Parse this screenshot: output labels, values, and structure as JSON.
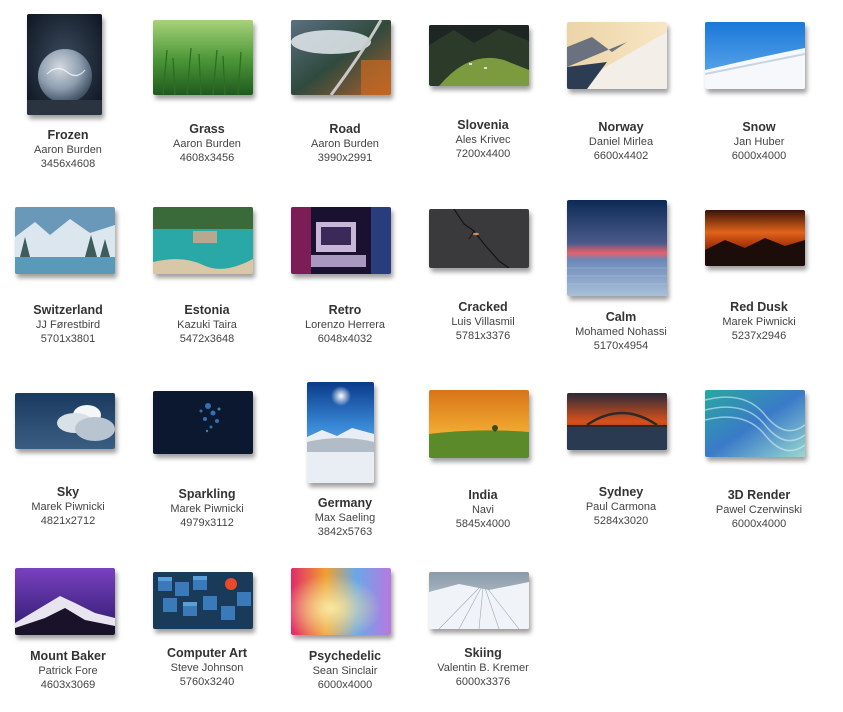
{
  "wallpapers": [
    {
      "name": "Frozen",
      "author": "Aaron Burden",
      "resolution": "3456x4608",
      "icon": "frozen-bubble-thumbnail"
    },
    {
      "name": "Grass",
      "author": "Aaron Burden",
      "resolution": "4608x3456",
      "icon": "grass-thumbnail"
    },
    {
      "name": "Road",
      "author": "Aaron Burden",
      "resolution": "3990x2991",
      "icon": "road-thumbnail"
    },
    {
      "name": "Slovenia",
      "author": "Ales Krivec",
      "resolution": "7200x4400",
      "icon": "slovenia-valley-thumbnail"
    },
    {
      "name": "Norway",
      "author": "Daniel Mirlea",
      "resolution": "6600x4402",
      "icon": "norway-snow-slope-thumbnail"
    },
    {
      "name": "Snow",
      "author": "Jan Huber",
      "resolution": "6000x4000",
      "icon": "snow-thumbnail"
    },
    {
      "name": "Switzerland",
      "author": "JJ Førestbird",
      "resolution": "5701x3801",
      "icon": "switzerland-lake-thumbnail"
    },
    {
      "name": "Estonia",
      "author": "Kazuki Taira",
      "resolution": "5472x3648",
      "icon": "estonia-water-thumbnail"
    },
    {
      "name": "Retro",
      "author": "Lorenzo Herrera",
      "resolution": "6048x4032",
      "icon": "retro-computer-thumbnail"
    },
    {
      "name": "Cracked",
      "author": "Luis Villasmil",
      "resolution": "5781x3376",
      "icon": "cracked-asphalt-thumbnail"
    },
    {
      "name": "Calm",
      "author": "Mohamed Nohassi",
      "resolution": "5170x4954",
      "icon": "calm-sea-sunset-thumbnail"
    },
    {
      "name": "Red Dusk",
      "author": "Marek Piwnicki",
      "resolution": "5237x2946",
      "icon": "red-dusk-mountains-thumbnail"
    },
    {
      "name": "Sky",
      "author": "Marek Piwnicki",
      "resolution": "4821x2712",
      "icon": "sky-clouds-thumbnail"
    },
    {
      "name": "Sparkling",
      "author": "Marek Piwnicki",
      "resolution": "4979x3112",
      "icon": "sparkling-lights-thumbnail"
    },
    {
      "name": "Germany",
      "author": "Max Saeling",
      "resolution": "3842x5763",
      "icon": "germany-sun-snow-thumbnail"
    },
    {
      "name": "India",
      "author": "Navi",
      "resolution": "5845x4000",
      "icon": "india-field-thumbnail"
    },
    {
      "name": "Sydney",
      "author": "Paul Carmona",
      "resolution": "5284x3020",
      "icon": "sydney-bridge-thumbnail"
    },
    {
      "name": "3D Render",
      "author": "Pawel Czerwinski",
      "resolution": "6000x4000",
      "icon": "3d-render-waves-thumbnail"
    },
    {
      "name": "Mount Baker",
      "author": "Patrick Fore",
      "resolution": "4603x3069",
      "icon": "mount-baker-thumbnail"
    },
    {
      "name": "Computer Art",
      "author": "Steve Johnson",
      "resolution": "5760x3240",
      "icon": "computer-art-cubes-thumbnail"
    },
    {
      "name": "Psychedelic",
      "author": "Sean Sinclair",
      "resolution": "6000x4000",
      "icon": "psychedelic-gradient-thumbnail"
    },
    {
      "name": "Skiing",
      "author": "Valentin B. Kremer",
      "resolution": "6000x3376",
      "icon": "skiing-slope-thumbnail"
    }
  ]
}
